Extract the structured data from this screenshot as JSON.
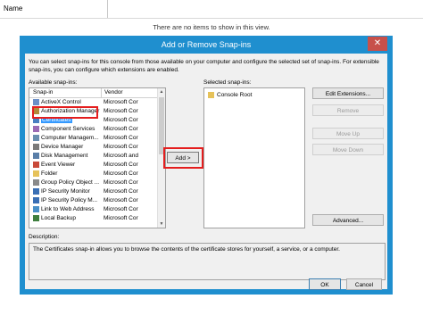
{
  "background": {
    "column_header": "Name",
    "empty_message": "There are no items to show in this view."
  },
  "dialog": {
    "title": "Add or Remove Snap-ins",
    "close_glyph": "✕",
    "intro": "You can select snap-ins for this console from those available on your computer and configure the selected set of snap-ins. For extensible snap-ins, you can configure which extensions are enabled.",
    "available_label": "Available snap-ins:",
    "selected_label": "Selected snap-ins:",
    "columns": {
      "snapin": "Snap-in",
      "vendor": "Vendor"
    },
    "available": [
      {
        "name": "ActiveX Control",
        "vendor": "Microsoft Cor",
        "icon": "activex-icon",
        "color": "#6b8fc7"
      },
      {
        "name": "Authorization Manager",
        "vendor": "Microsoft Cor",
        "icon": "authorization-icon",
        "color": "#b08a3a"
      },
      {
        "name": "Certificates",
        "vendor": "Microsoft Cor",
        "icon": "certificates-icon",
        "color": "#4a7fc1"
      },
      {
        "name": "Component Services",
        "vendor": "Microsoft Cor",
        "icon": "component-services-icon",
        "color": "#9c6bb5"
      },
      {
        "name": "Computer Managem...",
        "vendor": "Microsoft Cor",
        "icon": "computer-management-icon",
        "color": "#6a8fb0"
      },
      {
        "name": "Device Manager",
        "vendor": "Microsoft Cor",
        "icon": "device-manager-icon",
        "color": "#7a7a7a"
      },
      {
        "name": "Disk Management",
        "vendor": "Microsoft and",
        "icon": "disk-management-icon",
        "color": "#5a7ea8"
      },
      {
        "name": "Event Viewer",
        "vendor": "Microsoft Cor",
        "icon": "event-viewer-icon",
        "color": "#c94a3a"
      },
      {
        "name": "Folder",
        "vendor": "Microsoft Cor",
        "icon": "folder-icon",
        "color": "#e6c25a"
      },
      {
        "name": "Group Policy Object ...",
        "vendor": "Microsoft Cor",
        "icon": "group-policy-icon",
        "color": "#8a8a8a"
      },
      {
        "name": "IP Security Monitor",
        "vendor": "Microsoft Cor",
        "icon": "ip-security-monitor-icon",
        "color": "#3a6fb5"
      },
      {
        "name": "IP Security Policy M...",
        "vendor": "Microsoft Cor",
        "icon": "ip-security-policy-icon",
        "color": "#3a6fb5"
      },
      {
        "name": "Link to Web Address",
        "vendor": "Microsoft Cor",
        "icon": "link-icon",
        "color": "#4a90c8"
      },
      {
        "name": "Local Backup",
        "vendor": "Microsoft Cor",
        "icon": "local-backup-icon",
        "color": "#3f7f3f"
      }
    ],
    "selected": [
      {
        "name": "Console Root",
        "icon": "folder-icon",
        "color": "#e6c25a"
      }
    ],
    "buttons": {
      "add": "Add >",
      "edit_extensions": "Edit Extensions...",
      "remove": "Remove",
      "move_up": "Move Up",
      "move_down": "Move Down",
      "advanced": "Advanced...",
      "ok": "OK",
      "cancel": "Cancel"
    },
    "description_label": "Description:",
    "description": "The Certificates snap-in allows you to browse the contents of the certificate stores for yourself, a service, or a computer.",
    "selected_index": 2,
    "highlight_color": "#e41e1e"
  }
}
